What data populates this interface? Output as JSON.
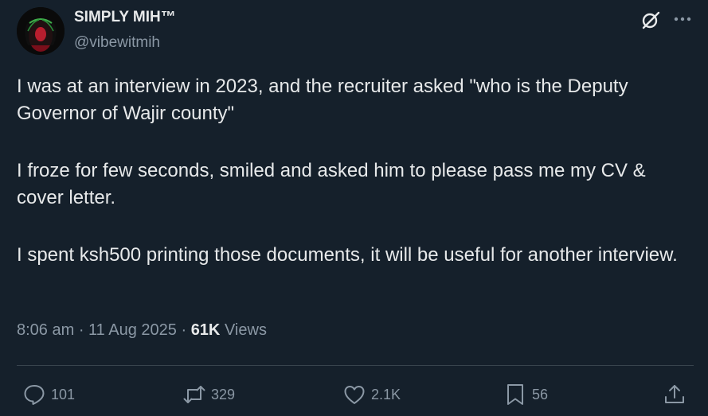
{
  "author": {
    "name": "SIMPLY MIH™",
    "handle": "@vibewitmih"
  },
  "post": {
    "paragraphs": [
      "I was at an interview in 2023, and the recruiter asked \"who is the Deputy Governor of Wajir county\"",
      "I froze for few seconds, smiled and asked him to please pass me my CV & cover letter.",
      "I spent ksh500 printing those documents, it will be useful for another interview."
    ],
    "time": "8:06 am",
    "date": "11 Aug 2025",
    "views_count": "61K",
    "views_label": "Views"
  },
  "actions": {
    "replies": "101",
    "reposts": "329",
    "likes": "2.1K",
    "bookmarks": "56"
  },
  "icons": {
    "header": [
      "grok-icon",
      "more-icon"
    ],
    "actions": [
      "reply-icon",
      "repost-icon",
      "like-icon",
      "bookmark-icon",
      "share-icon"
    ]
  },
  "colors": {
    "background": "#15202b",
    "text": "#e7e9ea",
    "secondary": "#8b98a5",
    "divider": "#38444d"
  }
}
